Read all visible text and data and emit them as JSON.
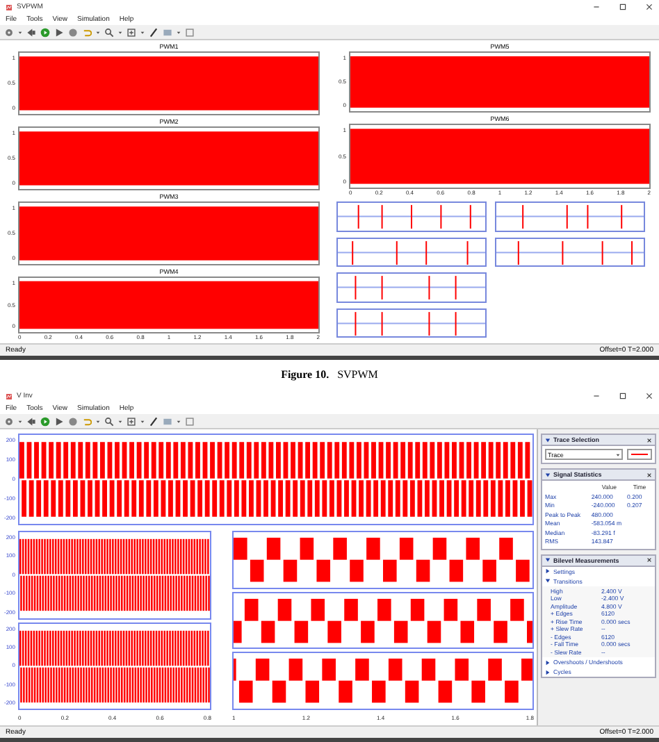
{
  "svpwm_window": {
    "title": "SVPWM",
    "menu": [
      "File",
      "Tools",
      "View",
      "Simulation",
      "Help"
    ],
    "left_plots": [
      {
        "title": "PWM1",
        "y_ticks": [
          "1",
          "0.5",
          "0"
        ],
        "kind": "pwm"
      },
      {
        "title": "PWM2",
        "y_ticks": [
          "1",
          "0.5",
          "0"
        ],
        "kind": "pwm"
      },
      {
        "title": "PWM3",
        "y_ticks": [
          "1",
          "0.5",
          "0"
        ],
        "kind": "pwm"
      },
      {
        "title": "PWM4",
        "y_ticks": [
          "1",
          "0.5",
          "0"
        ],
        "kind": "pwm"
      }
    ],
    "left_x_ticks": [
      "0",
      "0.2",
      "0.4",
      "0.6",
      "0.8",
      "1",
      "1.2",
      "1.4",
      "1.6",
      "1.8",
      "2"
    ],
    "right_plots": [
      {
        "title": "PWM5",
        "y_ticks": [
          "1",
          "0.5",
          "0"
        ],
        "kind": "pwm"
      },
      {
        "title": "PWM6",
        "y_ticks": [
          "1",
          "0.5",
          "0"
        ],
        "kind": "pwm"
      }
    ],
    "right_x_ticks": [
      "0",
      "0.2",
      "0.4",
      "0.6",
      "0.8",
      "1",
      "1.2",
      "1.4",
      "1.6",
      "1.8",
      "2"
    ],
    "status": {
      "left": "Ready",
      "right": "Offset=0 T=2.000"
    }
  },
  "caption": {
    "label": "Figure 10.",
    "text": "SVPWM"
  },
  "vinv_window": {
    "title": "V Inv",
    "menu": [
      "File",
      "Tools",
      "View",
      "Simulation",
      "Help"
    ],
    "top_plot": {
      "y_ticks": [
        "200",
        "100",
        "0",
        "-100",
        "-200"
      ],
      "kind": "bipolar"
    },
    "left_plots": [
      {
        "y_ticks": [
          "200",
          "100",
          "0",
          "-100",
          "-200"
        ],
        "kind": "bipolar"
      },
      {
        "y_ticks": [
          "200",
          "100",
          "0",
          "-100",
          "-200"
        ],
        "kind": "bipolar"
      }
    ],
    "right_plots": [
      {
        "kind": "square"
      },
      {
        "kind": "square"
      },
      {
        "kind": "square"
      }
    ],
    "left_x_ticks": [
      "0",
      "0.2",
      "0.4",
      "0.6",
      "0.8"
    ],
    "right_x_ticks": [
      "1",
      "1.2",
      "1.4",
      "1.6",
      "1.8"
    ],
    "panel": [
      {
        "title": "Trace Selection",
        "kind": "select",
        "value": "Trace"
      },
      {
        "title": "Signal Statistics",
        "kind": "table",
        "columns": [
          "",
          "Value",
          "Time"
        ],
        "rows": [
          [
            "Max",
            "240.000",
            "0.200"
          ],
          [
            "Min",
            "-240.000",
            "0.207"
          ],
          [
            "Peak to Peak",
            "480.000",
            ""
          ],
          [
            "Mean",
            "-583.054 m",
            ""
          ],
          [
            "Median",
            "-83.291 f",
            ""
          ],
          [
            "RMS",
            "143.847",
            ""
          ]
        ]
      },
      {
        "title": "Bilevel Measurements",
        "kind": "tree",
        "items": [
          {
            "label": "Settings",
            "expanded": false
          },
          {
            "label": "Transitions",
            "expanded": true,
            "rows": [
              [
                "High",
                "2.400 V"
              ],
              [
                "Low",
                "-2.400 V"
              ],
              [
                "Amplitude",
                "4.800 V"
              ],
              [
                "+ Edges",
                "6120"
              ],
              [
                "+ Rise Time",
                "0.000 secs"
              ],
              [
                "+ Slew Rate",
                "--"
              ],
              [
                "- Edges",
                "6120"
              ],
              [
                "- Fall Time",
                "0.000 secs"
              ],
              [
                "- Slew Rate",
                "--"
              ]
            ]
          },
          {
            "label": "Overshoots / Undershoots",
            "expanded": false
          },
          {
            "label": "Cycles",
            "expanded": false
          }
        ]
      }
    ],
    "status": {
      "left": "Ready",
      "right": "Offset=0 T=2.000"
    }
  }
}
